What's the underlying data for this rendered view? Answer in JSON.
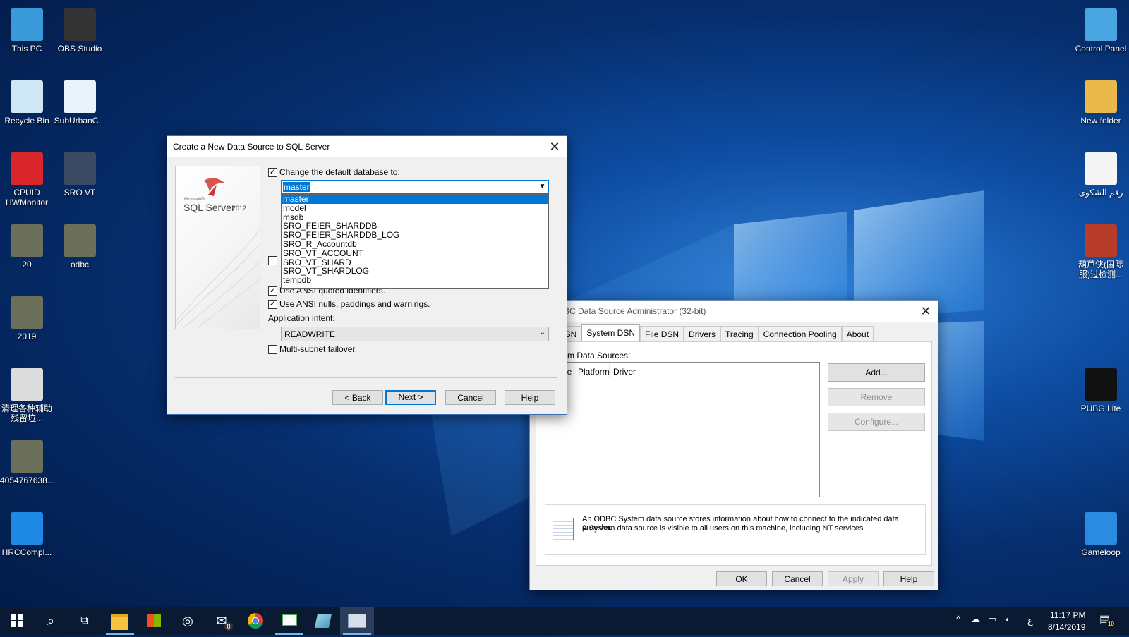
{
  "desktop": {
    "icons_left": [
      {
        "label": "This PC",
        "icon": "computer-icon"
      },
      {
        "label": "OBS Studio",
        "icon": "obs-icon"
      },
      {
        "label": "Recycle Bin",
        "icon": "recycle-bin-icon"
      },
      {
        "label": "SubUrbanC...",
        "icon": "app-icon"
      },
      {
        "label": "CPUID HWMonitor",
        "icon": "hwmonitor-icon"
      },
      {
        "label": "SRO VT",
        "icon": "folder-image-icon"
      },
      {
        "label": "20",
        "icon": "image-icon"
      },
      {
        "label": "odbc",
        "icon": "image-icon"
      },
      {
        "label": "2019",
        "icon": "image-icon"
      },
      {
        "label": "清理各种辅助残留垃...",
        "icon": "gear-app-icon"
      },
      {
        "label": "4054767638...",
        "icon": "image-icon"
      },
      {
        "label": "HRCCompl...",
        "icon": "file-icon"
      }
    ],
    "icons_right": [
      {
        "label": "Control Panel",
        "icon": "control-panel-icon"
      },
      {
        "label": "New folder",
        "icon": "folder-icon"
      },
      {
        "label": "رقم الشكوى",
        "icon": "text-file-icon"
      },
      {
        "label": "葫芦侠(国际服)过检测...",
        "icon": "archive-icon"
      },
      {
        "label": "PUBG Lite",
        "icon": "pubg-icon"
      },
      {
        "label": "Gameloop",
        "icon": "gameloop-icon"
      }
    ]
  },
  "odbc_admin": {
    "title": "ODBC Data Source Administrator (32-bit)",
    "tabs": [
      "DSN",
      "System DSN",
      "File DSN",
      "Drivers",
      "Tracing",
      "Connection Pooling",
      "About"
    ],
    "active_tab": "System DSN",
    "list_label": "stem Data Sources:",
    "columns": [
      "ame",
      "Platform",
      "Driver"
    ],
    "buttons": {
      "add": "Add...",
      "remove": "Remove",
      "configure": "Configure..."
    },
    "info_text_1": "An ODBC System data source stores information about how to connect to the indicated data provider.",
    "info_text_2": "A System data source is visible to all users on this machine, including NT services.",
    "footer": {
      "ok": "OK",
      "cancel": "Cancel",
      "apply": "Apply",
      "help": "Help"
    }
  },
  "create_dialog": {
    "title": "Create a New Data Source to SQL Server",
    "logo_small": "Microsoft®",
    "logo_text": "SQL Server",
    "logo_year": "2012",
    "change_db_label": "Change the default database to:",
    "db_selected": "master",
    "db_options": [
      "master",
      "model",
      "msdb",
      "SRO_FEIER_SHARDDB",
      "SRO_FEIER_SHARDDB_LOG",
      "SRO_R_Accountdb",
      "SRO_VT_ACCOUNT",
      "SRO_VT_SHARD",
      "SRO_VT_SHARDLOG",
      "tempdb"
    ],
    "ansi_quoted": "Use ANSI quoted identifiers.",
    "ansi_nulls": "Use ANSI nulls, paddings and warnings.",
    "app_intent_label": "Application intent:",
    "app_intent_value": "READWRITE",
    "multisubnet": "Multi-subnet failover.",
    "buttons": {
      "back": "< Back",
      "next": "Next >",
      "cancel": "Cancel",
      "help": "Help"
    }
  },
  "taskbar": {
    "time": "11:17 PM",
    "date": "8/14/2019",
    "lang": "ع",
    "mail_badge": "8",
    "notif_badge": "10"
  }
}
